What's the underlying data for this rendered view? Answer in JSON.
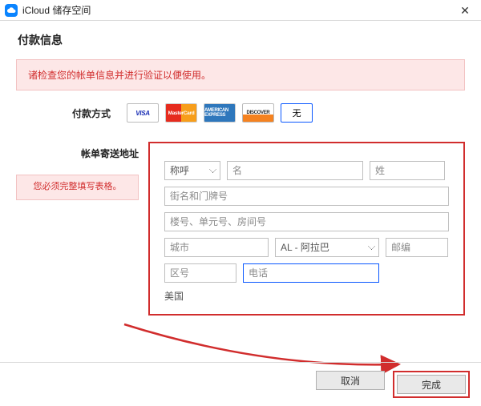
{
  "window": {
    "title": "iCloud 储存空间"
  },
  "heading": "付款信息",
  "alert": "诸检查您的帐单信息并进行验证以便使用。",
  "payment": {
    "label": "付款方式",
    "options": {
      "visa": "VISA",
      "mastercard": "MasterCard",
      "amex": "AMERICAN EXPRESS",
      "discover": "DISCOVER",
      "none": "无"
    }
  },
  "billing": {
    "section_label": "帐单寄送地址",
    "warning": "您必须完整填写表格。",
    "salutation_placeholder": "称呼",
    "firstname_placeholder": "名",
    "lastname_placeholder": "姓",
    "street_placeholder": "街名和门牌号",
    "unit_placeholder": "楼号、单元号、房间号",
    "city_placeholder": "城市",
    "state_value": "AL - 阿拉巴",
    "zip_placeholder": "邮编",
    "areacode_placeholder": "区号",
    "phone_placeholder": "电话",
    "country": "美国"
  },
  "buttons": {
    "cancel": "取消",
    "done": "完成"
  }
}
